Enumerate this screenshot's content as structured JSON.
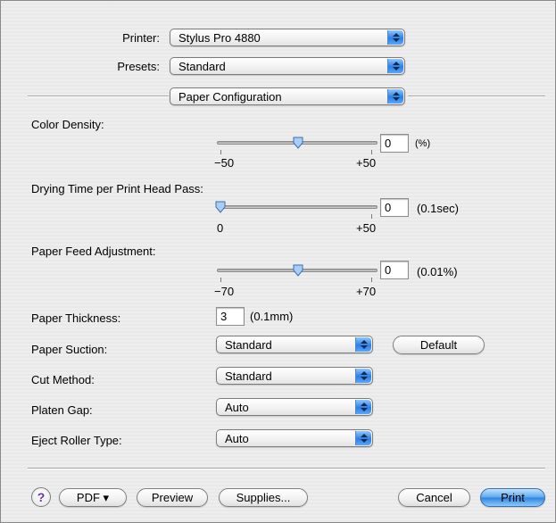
{
  "printer": {
    "label": "Printer:",
    "value": "Stylus Pro 4880"
  },
  "presets": {
    "label": "Presets:",
    "value": "Standard"
  },
  "panel": {
    "value": "Paper Configuration"
  },
  "color_density": {
    "label": "Color Density:",
    "value": "0",
    "unit": "(%)",
    "min_label": "−50",
    "max_label": "+50",
    "min": -50,
    "max": 50,
    "current": 0
  },
  "drying_time": {
    "label": "Drying Time per Print Head Pass:",
    "value": "0",
    "unit": "(0.1sec)",
    "min_label": "0",
    "max_label": "+50",
    "min": 0,
    "max": 50,
    "current": 0
  },
  "paper_feed": {
    "label": "Paper Feed Adjustment:",
    "value": "0",
    "unit": "(0.01%)",
    "min_label": "−70",
    "max_label": "+70",
    "min": -70,
    "max": 70,
    "current": 0
  },
  "paper_thickness": {
    "label": "Paper Thickness:",
    "value": "3",
    "unit": "(0.1mm)"
  },
  "paper_suction": {
    "label": "Paper Suction:",
    "value": "Standard",
    "default_button": "Default"
  },
  "cut_method": {
    "label": "Cut Method:",
    "value": "Standard"
  },
  "platen_gap": {
    "label": "Platen Gap:",
    "value": "Auto"
  },
  "eject_roller": {
    "label": "Eject Roller Type:",
    "value": "Auto"
  },
  "footer": {
    "help": "?",
    "pdf": "PDF ▾",
    "preview": "Preview",
    "supplies": "Supplies...",
    "cancel": "Cancel",
    "print": "Print"
  }
}
